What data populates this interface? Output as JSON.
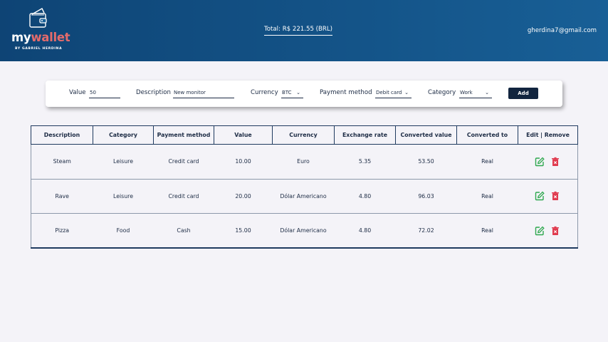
{
  "header": {
    "logo_my": "my",
    "logo_wallet": "wallet",
    "logo_by": "BY GABRIEL HERDINA",
    "total": "Total: R$ 221.55 (BRL)",
    "email": "gherdina7@gmail.com"
  },
  "form": {
    "value_label": "Value",
    "value": "50",
    "description_label": "Description",
    "description": "New monitor",
    "currency_label": "Currency",
    "currency": "BTC",
    "payment_label": "Payment method",
    "payment": "Debit card",
    "category_label": "Category",
    "category": "Work",
    "add_label": "Add"
  },
  "table": {
    "headers": [
      "Description",
      "Category",
      "Payment method",
      "Value",
      "Currency",
      "Exchange rate",
      "Converted value",
      "Converted to",
      "Edit | Remove"
    ],
    "rows": [
      [
        "Steam",
        "Leisure",
        "Credit card",
        "10.00",
        "Euro",
        "5.35",
        "53.50",
        "Real"
      ],
      [
        "Rave",
        "Leisure",
        "Credit card",
        "20.00",
        "Dólar Americano",
        "4.80",
        "96.03",
        "Real"
      ],
      [
        "Pizza",
        "Food",
        "Cash",
        "15.00",
        "Dólar Americano",
        "4.80",
        "72.02",
        "Real"
      ]
    ]
  },
  "colors": {
    "header_bg": "#0e4475",
    "brand_accent": "#e46b6b",
    "edit_icon": "#2fa84f",
    "delete_icon": "#e03a4e"
  },
  "icons": {
    "logo": "wallet-icon",
    "edit": "edit-icon",
    "delete": "trash-icon",
    "select": "chevron-down-icon"
  }
}
